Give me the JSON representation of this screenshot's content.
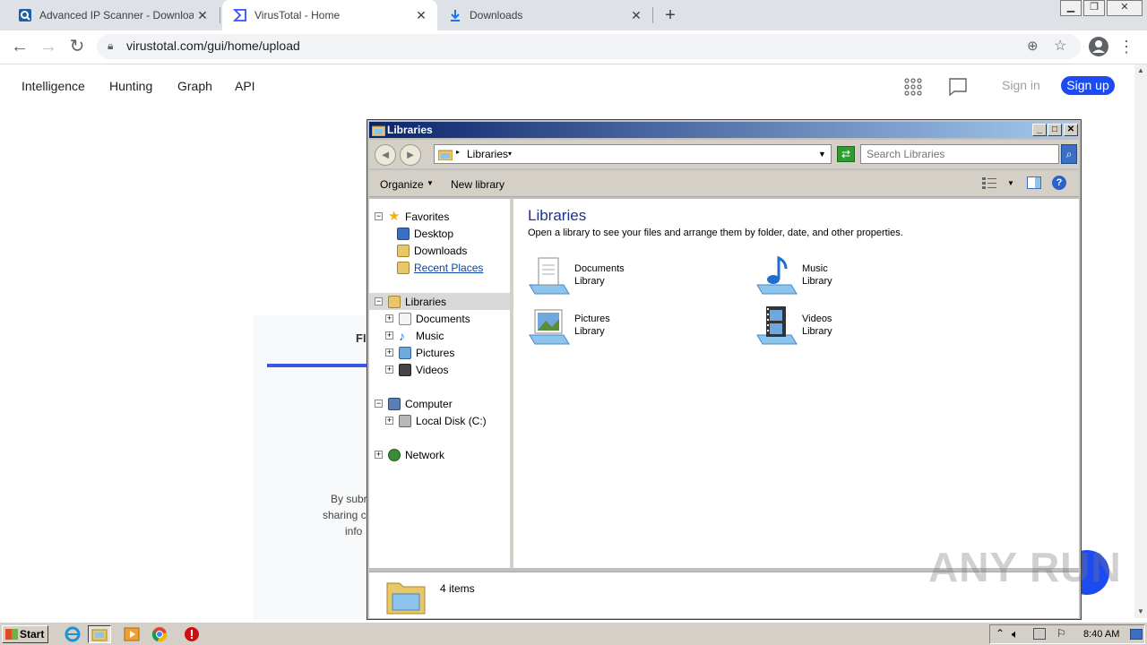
{
  "browser": {
    "tabs": [
      {
        "title": "Advanced IP Scanner - Download Fr",
        "active": false
      },
      {
        "title": "VirusTotal - Home",
        "active": true
      },
      {
        "title": "Downloads",
        "active": false
      }
    ],
    "new_tab": "+",
    "url": "virustotal.com/gui/home/upload"
  },
  "virustotal": {
    "nav": [
      "Intelligence",
      "Hunting",
      "Graph",
      "API"
    ],
    "sign_in": "Sign in",
    "sign_up": "Sign up",
    "card_title_fragment": "FI",
    "card_text_fragments": [
      "By subr",
      "sharing c",
      "info"
    ]
  },
  "explorer": {
    "title": "Libraries",
    "address": "Libraries",
    "search_placeholder": "Search Libraries",
    "commands": {
      "organize": "Organize",
      "new_library": "New library"
    },
    "nav": {
      "favorites": {
        "label": "Favorites",
        "items": [
          "Desktop",
          "Downloads",
          "Recent Places"
        ]
      },
      "libraries": {
        "label": "Libraries",
        "items": [
          "Documents",
          "Music",
          "Pictures",
          "Videos"
        ]
      },
      "computer": {
        "label": "Computer",
        "items": [
          "Local Disk (C:)"
        ]
      },
      "network": {
        "label": "Network"
      }
    },
    "content": {
      "heading": "Libraries",
      "description": "Open a library to see your files and arrange them by folder, date, and other properties.",
      "libraries": [
        {
          "name": "Documents",
          "type": "Library",
          "icon": "documents-icon"
        },
        {
          "name": "Music",
          "type": "Library",
          "icon": "music-icon"
        },
        {
          "name": "Pictures",
          "type": "Library",
          "icon": "pictures-icon"
        },
        {
          "name": "Videos",
          "type": "Library",
          "icon": "videos-icon"
        }
      ]
    },
    "status": "4 items"
  },
  "taskbar": {
    "start": "Start",
    "clock": "8:40 AM"
  },
  "watermark": "ANY RUN"
}
